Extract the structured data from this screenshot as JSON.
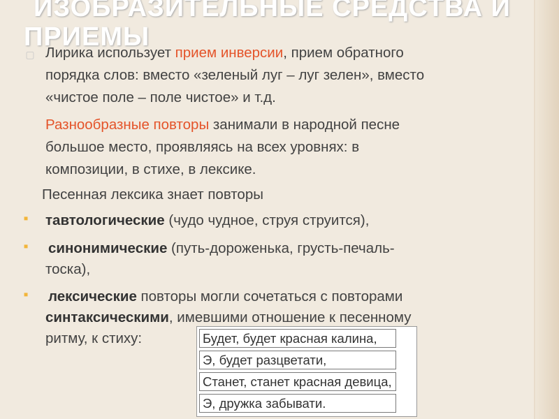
{
  "title": {
    "line1": "ИЗОБРАЗИТЕЛЬНЫЕ СРЕДСТВА И",
    "line2": "ПРИЕМЫ"
  },
  "paragraph1": {
    "t1": "Лирика использует ",
    "h1": "прием инверсии",
    "t2": ", прием обратного",
    "l2": "порядка слов: вместо «зеленый луг – луг зелен», вместо",
    "l3": "«чистое поле – поле чистое» и т.д."
  },
  "paragraph2": {
    "h1": "Разнообразные повторы",
    "t1": " занимали в народной песне",
    "l2": "большое место, проявляясь на всех уровнях: в",
    "l3": "композиции, в стихе, в лексике."
  },
  "intro_line": "Песенная лексика знает повторы",
  "bullets": [
    {
      "bold": "тавтологические",
      "rest": " (чудо чудное, струя струится),"
    },
    {
      "bold": "синонимические",
      "rest": " (путь-дороженька, грусть-печаль-",
      "cont": "тоска),"
    },
    {
      "bold": "лексические",
      "rest": " повторы могли сочетаться с повторами",
      "bold2": "синтаксическими",
      "rest2": ", имевшими отношение к песенному",
      "cont": "ритму, к стиху:"
    }
  ],
  "song_lines": [
    "Будет, будет красная калина,",
    "Э, будет разцветати,",
    "Станет, станет красная девица,",
    "Э, дружка забывати."
  ],
  "colors": {
    "accent": "#e4542a",
    "bullet": "#f2b53a",
    "background": "#f1eadf",
    "text": "#424242"
  },
  "icons": {
    "first_bullet": "square-bullet-icon",
    "list_bullets": "dot-bullet-icon"
  }
}
